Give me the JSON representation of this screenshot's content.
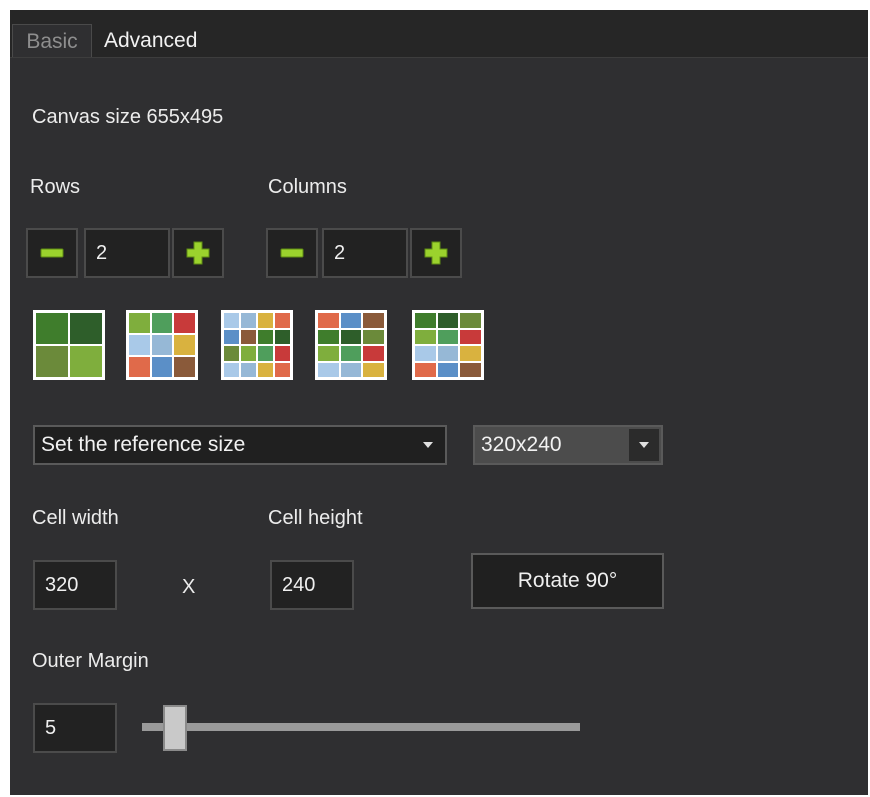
{
  "tabs": [
    {
      "label": "Basic",
      "active": true
    },
    {
      "label": "Advanced",
      "active": false
    }
  ],
  "canvas_size_label": "Canvas size 655x495",
  "rows": {
    "label": "Rows",
    "value": "2"
  },
  "columns": {
    "label": "Columns",
    "value": "2"
  },
  "icons": {
    "decrement": "minus-icon",
    "increment": "plus-icon"
  },
  "layout_presets": [
    {
      "name": "2x2 grid"
    },
    {
      "name": "3x3 grid"
    },
    {
      "name": "4x4 grid"
    },
    {
      "name": "4x4 grid variant"
    },
    {
      "name": "4x4 grid variant"
    }
  ],
  "reference_size_dropdown": {
    "selected": "Set the reference size"
  },
  "size_preset_dropdown": {
    "selected": "320x240"
  },
  "cell_width": {
    "label": "Cell width",
    "value": "320"
  },
  "times_symbol": "X",
  "cell_height": {
    "label": "Cell height",
    "value": "240"
  },
  "rotate_button": {
    "label": "Rotate 90°"
  },
  "outer_margin": {
    "label": "Outer Margin",
    "value": "5"
  },
  "outer_margin_slider": {
    "level": 0.05
  },
  "colors": {
    "panel_bg": "#2f2f31",
    "field_bg": "#222222",
    "accent_green": "#9bd22d"
  }
}
